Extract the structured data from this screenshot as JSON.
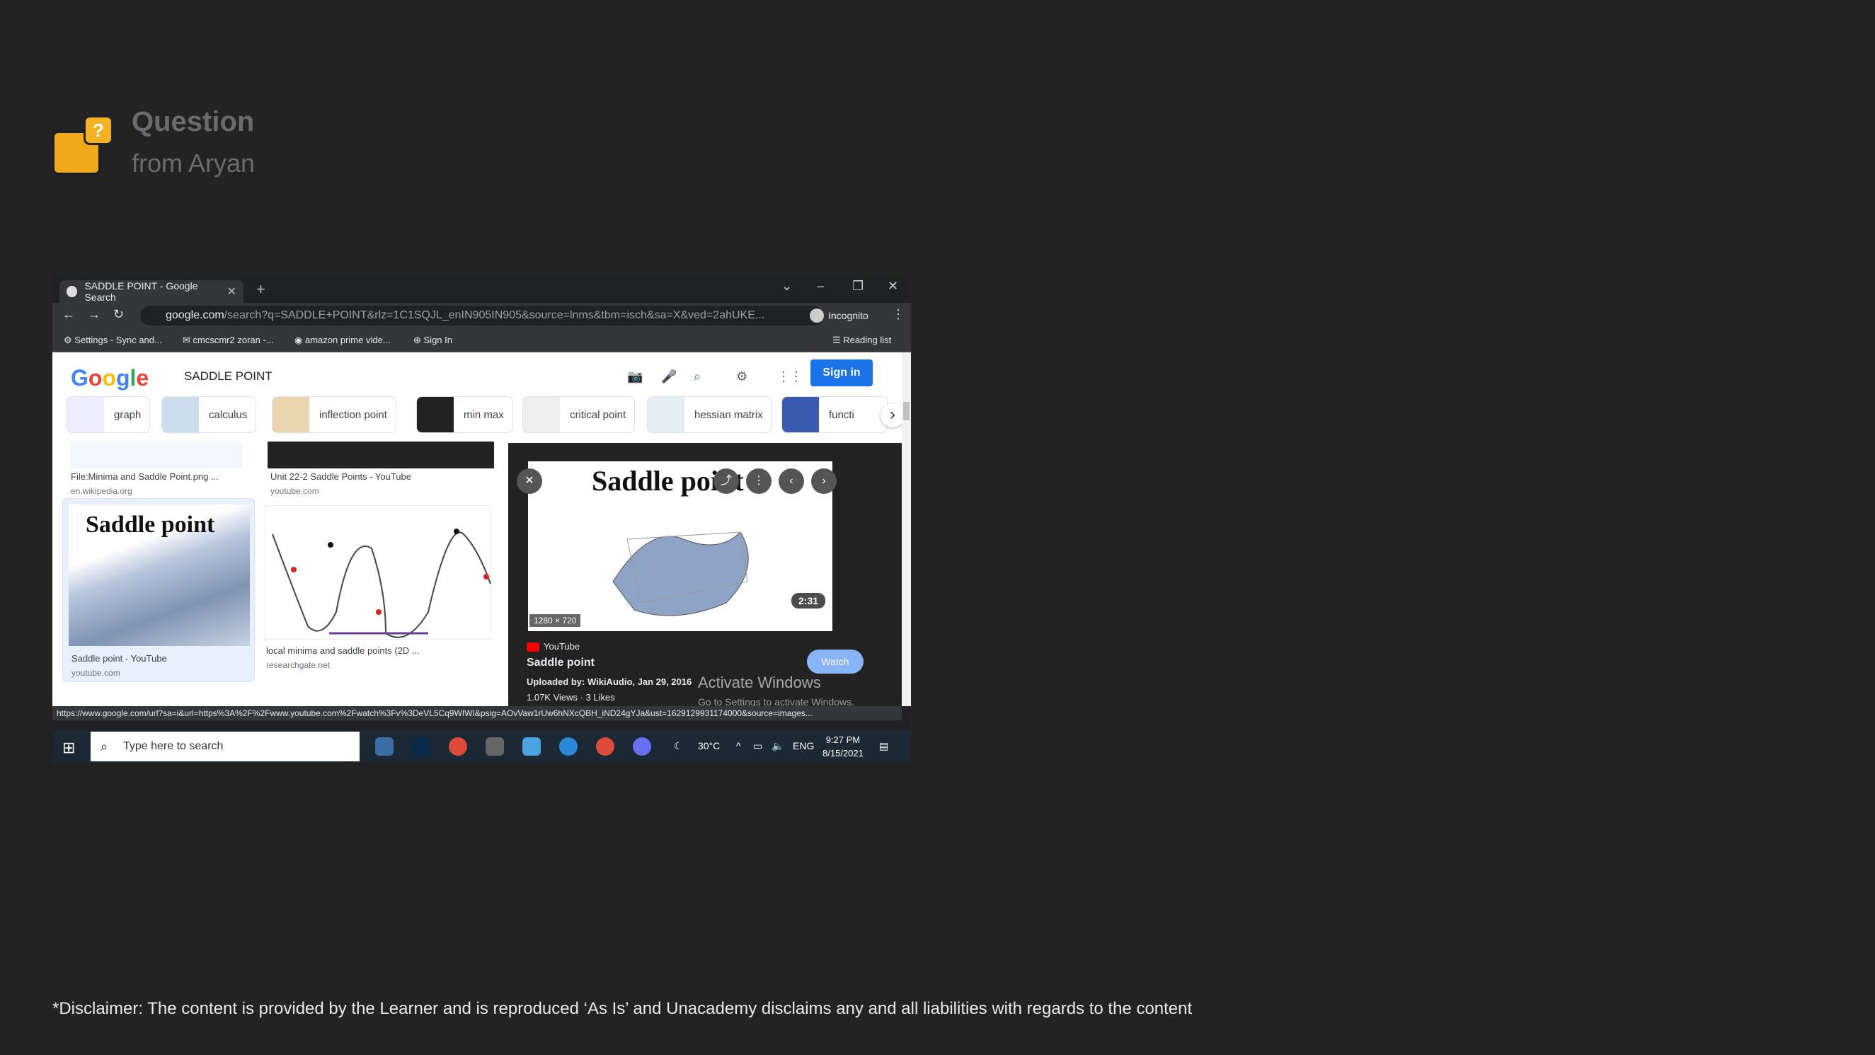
{
  "header": {
    "title": "Question",
    "subtitle": "from Aryan",
    "badge_icon": "question-mark-icon"
  },
  "browser": {
    "tab_title": "SADDLE POINT - Google Search",
    "url_host": "google.com",
    "url_path": "/search?q=SADDLE+POINT&rlz=1C1SQJL_enIN905IN905&source=lnms&tbm=isch&sa=X&ved=2ahUKE...",
    "profile": "Incognito",
    "bookmarks": [
      "Settings - Sync and...",
      "cmcscmr2 zoran -...",
      "amazon prime vide...",
      "Sign In"
    ],
    "reading_list": "Reading list",
    "status_url": "https://www.google.com/url?sa=i&url=https%3A%2F%2Fwww.youtube.com%2Fwatch%3Fv%3DeVL5Cq9WIWI&psig=AOvVaw1rUw6hNXcQBH_iND24gYJa&ust=1629129931174000&source=images..."
  },
  "google": {
    "query": "SADDLE POINT",
    "signin": "Sign in",
    "chips": [
      "graph",
      "calculus",
      "inflection point",
      "min max",
      "critical point",
      "hessian matrix",
      "functi"
    ]
  },
  "results": [
    {
      "title": "File:Minima and Saddle Point.png ...",
      "source": "en.wikipedia.org"
    },
    {
      "title": "Unit 22-2 Saddle Points - YouTube",
      "source": "youtube.com"
    },
    {
      "title": "Saddle point - YouTube",
      "source": "youtube.com",
      "image_text": "Saddle point"
    },
    {
      "title": "local minima and saddle points (2D ...",
      "source": "researchgate.net"
    }
  ],
  "preview": {
    "image_text": "Saddle point",
    "resolution": "1280 × 720",
    "duration": "2:31",
    "source": "YouTube",
    "title": "Saddle point",
    "uploaded": "Uploaded by: WikiAudio, Jan 29, 2016",
    "views": "1.07K Views",
    "likes": "3 Likes",
    "watch": "Watch"
  },
  "watermark": {
    "line1": "Activate Windows",
    "line2": "Go to Settings to activate Windows."
  },
  "taskbar": {
    "search_placeholder": "Type here to search",
    "weather": "30°C",
    "lang": "ENG",
    "time": "9:27 PM",
    "date": "8/15/2021"
  },
  "disclaimer": "*Disclaimer: The content is provided by the Learner and is reproduced ‘As Is’ and Unacademy disclaims any and all liabilities with regards to the content"
}
